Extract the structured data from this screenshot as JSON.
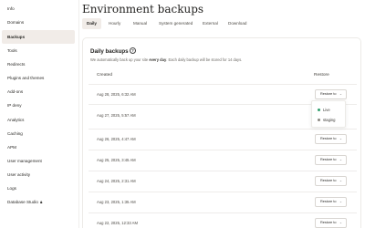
{
  "sidebar": {
    "items": [
      {
        "label": "Info"
      },
      {
        "label": "Domains"
      },
      {
        "label": "Backups"
      },
      {
        "label": "Tools"
      },
      {
        "label": "Redirects"
      },
      {
        "label": "Plugins and themes"
      },
      {
        "label": "Add-ons"
      },
      {
        "label": "IP deny"
      },
      {
        "label": "Analytics"
      },
      {
        "label": "Caching"
      },
      {
        "label": "APM"
      },
      {
        "label": "User management"
      },
      {
        "label": "User activity"
      },
      {
        "label": "Logs"
      },
      {
        "label": "Database Studio"
      }
    ],
    "active_index": 2
  },
  "header": {
    "title": "Environment backups"
  },
  "tabs": [
    {
      "label": "Daily"
    },
    {
      "label": "Hourly"
    },
    {
      "label": "Manual"
    },
    {
      "label": "System generated"
    },
    {
      "label": "External"
    },
    {
      "label": "Download"
    }
  ],
  "card": {
    "title": "Daily backups",
    "desc_prefix": "We automatically back up your site ",
    "desc_bold": "every day",
    "desc_suffix": ". Each daily backup will be stored for 14 days."
  },
  "table": {
    "col_created": "Created",
    "col_restore": "Restore",
    "restore_label": "Restore to",
    "rows": [
      {
        "date": "Aug 28, 2025, 6:32 AM"
      },
      {
        "date": "Aug 27, 2025, 5:57 AM"
      },
      {
        "date": "Aug 26, 2025, 4:47 AM"
      },
      {
        "date": "Aug 25, 2025, 3:45 AM"
      },
      {
        "date": "Aug 24, 2025, 2:31 AM"
      },
      {
        "date": "Aug 23, 2025, 1:35 AM"
      },
      {
        "date": "Aug 22, 2025, 12:33 AM"
      }
    ]
  },
  "dropdown": {
    "items": [
      {
        "label": "Live",
        "color": "#2e9e6b"
      },
      {
        "label": "staging",
        "color": "#8a8780"
      }
    ]
  },
  "colors": {
    "accent_bg": "#f1ece8"
  }
}
